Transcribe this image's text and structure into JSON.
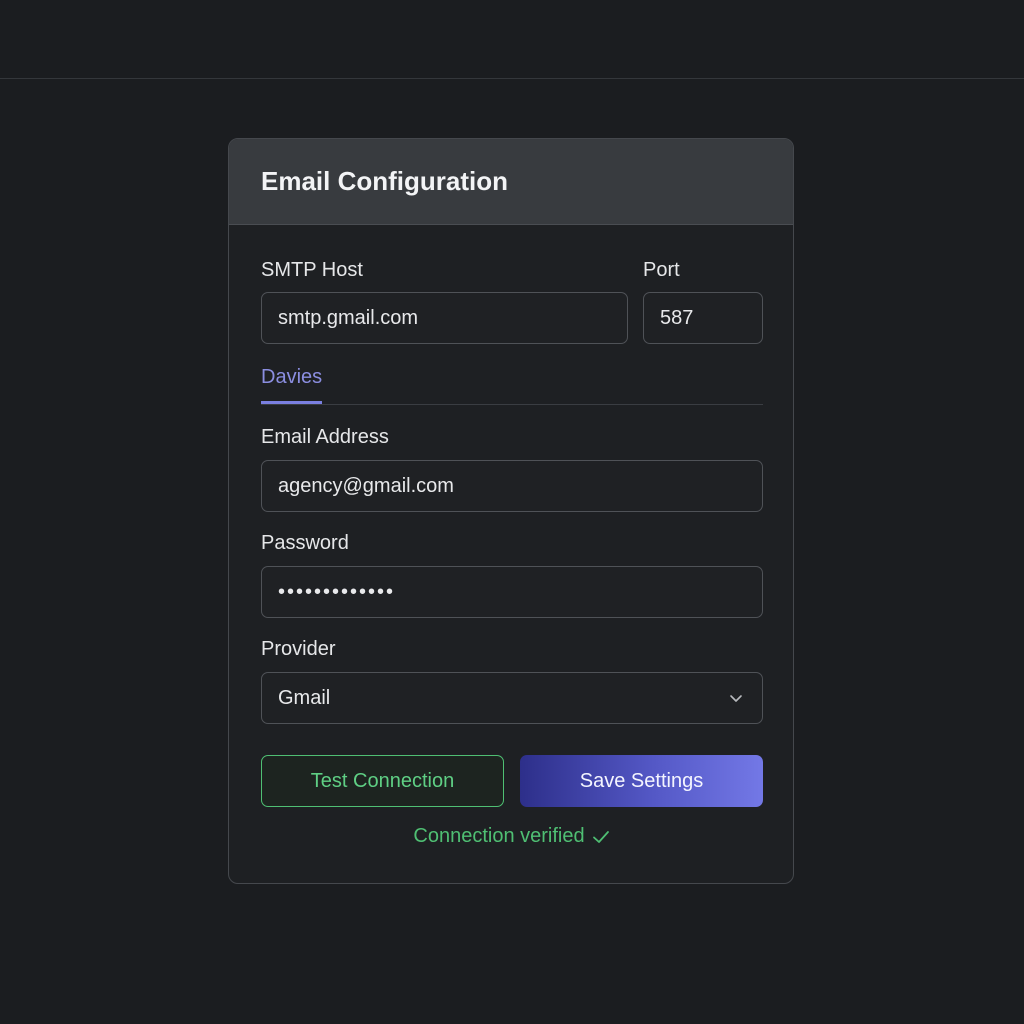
{
  "card": {
    "title": "Email Configuration"
  },
  "smtp": {
    "host_label": "SMTP Host",
    "host_value": "smtp.gmail.com",
    "port_label": "Port",
    "port_value": "587"
  },
  "tabs": [
    {
      "label": "Davies",
      "active": true
    }
  ],
  "email": {
    "label": "Email Address",
    "value": "agency@gmail.com"
  },
  "password": {
    "label": "Password",
    "masked_value": "•••••••••••••"
  },
  "provider": {
    "label": "Provider",
    "selected": "Gmail",
    "icon": "chevron-down-icon"
  },
  "actions": {
    "test_label": "Test Connection",
    "save_label": "Save Settings"
  },
  "status": {
    "text": "Connection verified",
    "icon": "checkmark-icon",
    "color": "#4fbf73"
  },
  "colors": {
    "background": "#1b1d20",
    "accent": "#7a7fe0",
    "success": "#4fbf73"
  }
}
